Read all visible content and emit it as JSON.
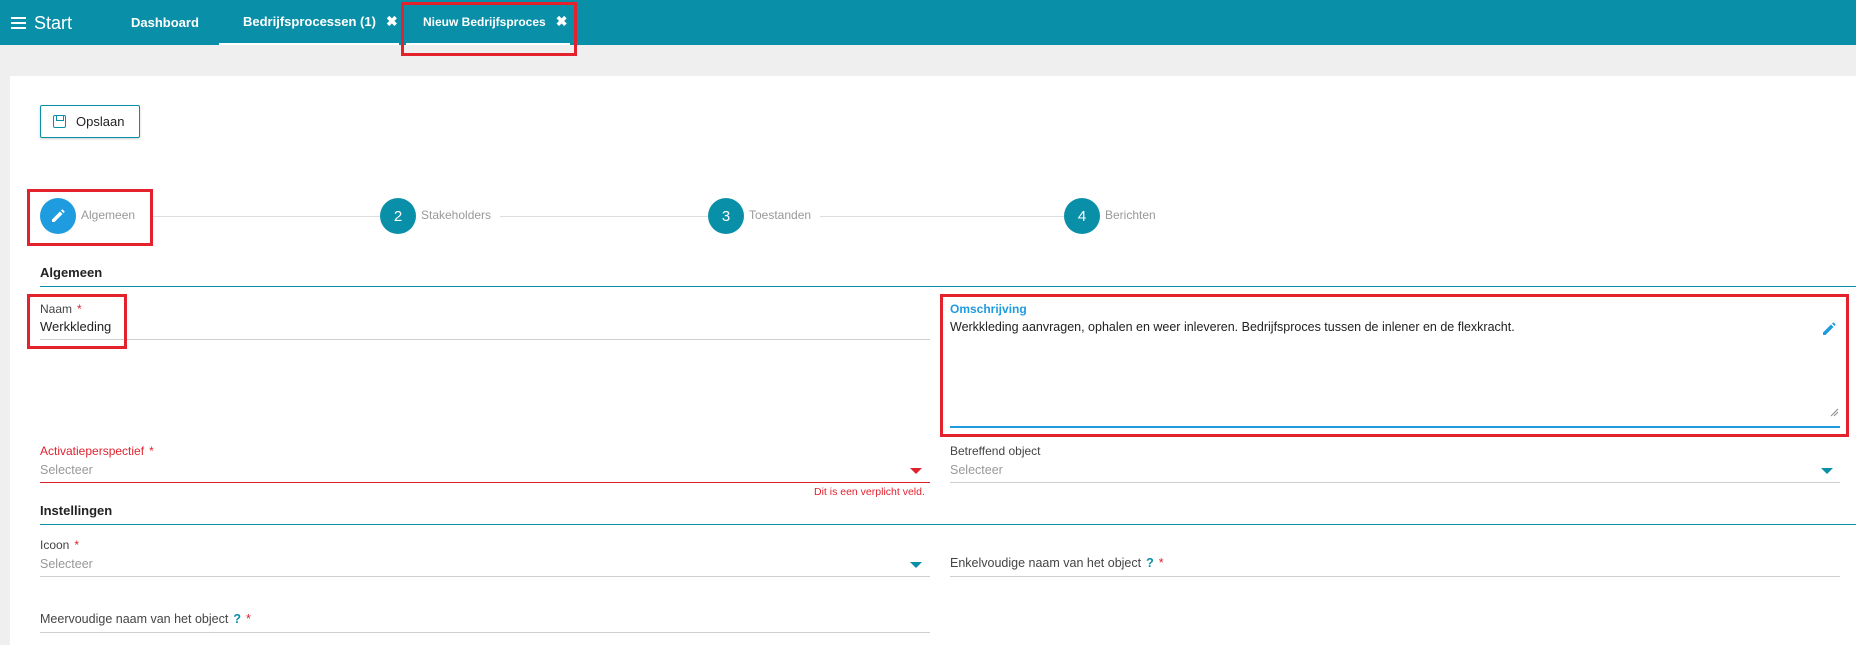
{
  "topbar": {
    "start_label": "Start",
    "tabs": [
      {
        "label": "Dashboard"
      },
      {
        "label": "Bedrijfsprocessen (1)",
        "close": "✖"
      },
      {
        "label": "Nieuw Bedrijfsproces",
        "close": "✖"
      }
    ]
  },
  "toolbar": {
    "save_label": "Opslaan"
  },
  "stepper": {
    "steps": [
      {
        "number": "",
        "label": "Algemeen"
      },
      {
        "number": "2",
        "label": "Stakeholders"
      },
      {
        "number": "3",
        "label": "Toestanden"
      },
      {
        "number": "4",
        "label": "Berichten"
      }
    ]
  },
  "algemeen": {
    "section_title": "Algemeen",
    "naam": {
      "label": "Naam",
      "required": "*",
      "value": "Werkkleding"
    },
    "omschrijving": {
      "label": "Omschrijving",
      "value": "Werkkleding aanvragen, ophalen en weer inleveren. Bedrijfsproces tussen de inlener en de flexkracht."
    },
    "activatieperspectief": {
      "label": "Activatieperspectief",
      "required": "*",
      "placeholder": "Selecteer",
      "error": "Dit is een verplicht veld."
    },
    "betreffend_object": {
      "label": "Betreffend object",
      "placeholder": "Selecteer"
    }
  },
  "instellingen": {
    "section_title": "Instellingen",
    "icoon": {
      "label": "Icoon",
      "required": "*",
      "placeholder": "Selecteer"
    },
    "enkelvoudige_naam": {
      "label": "Enkelvoudige naam van het object",
      "help": "?",
      "required": "*"
    },
    "meervoudige_naam": {
      "label": "Meervoudige naam van het object",
      "help": "?",
      "required": "*"
    }
  },
  "colors": {
    "header": "#0a8fa8",
    "accent": "#0a8fa8",
    "active_step": "#1f9be0",
    "required": "#e0222f",
    "highlight": "#e3222d"
  }
}
